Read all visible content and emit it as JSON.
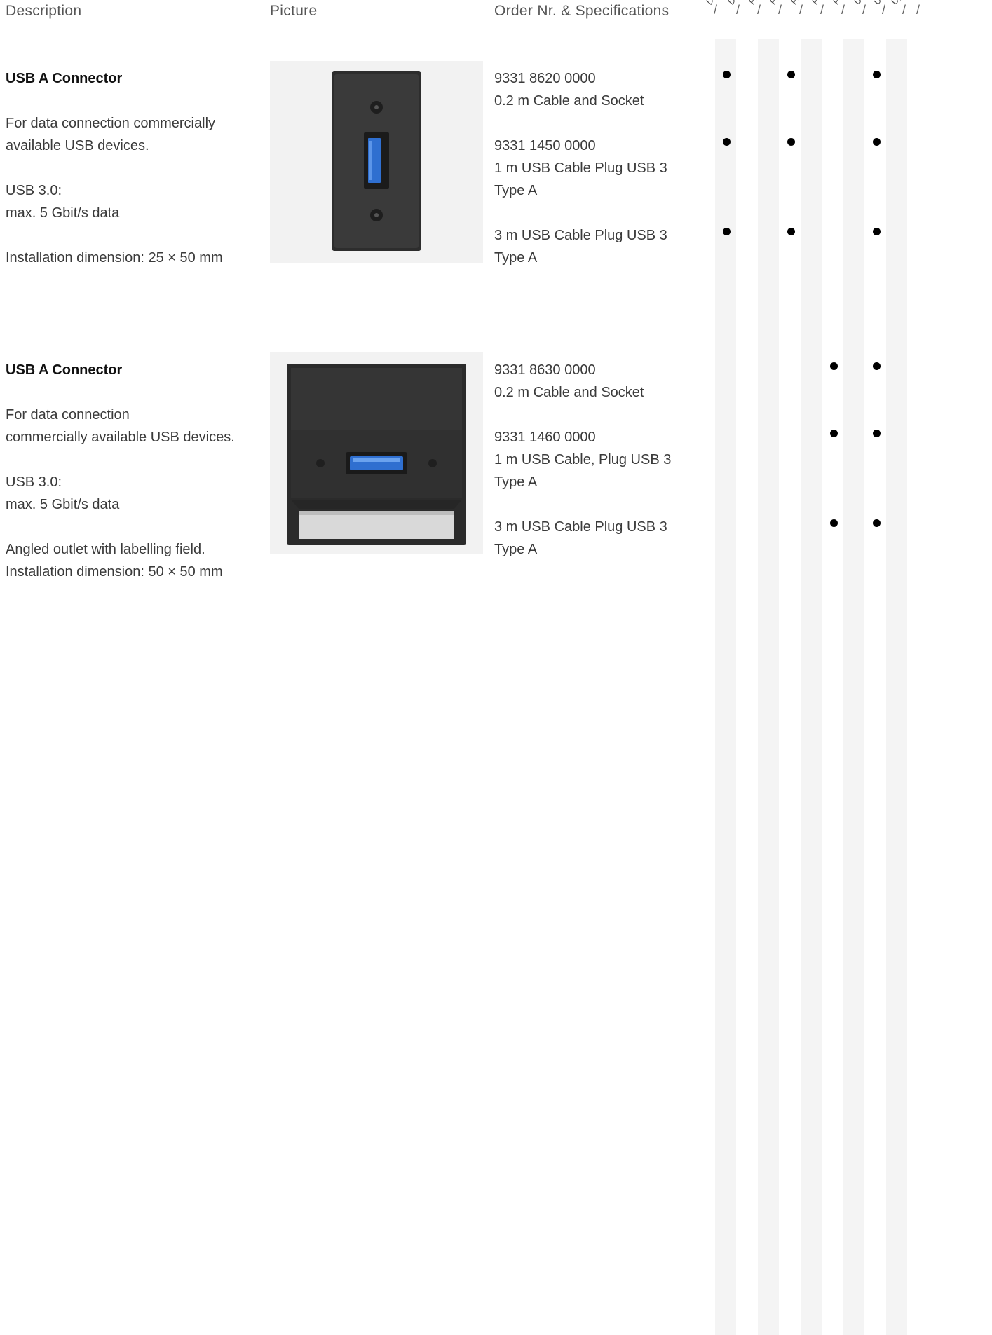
{
  "header": {
    "description": "Description",
    "picture": "Picture",
    "order": "Order Nr. & Specifications",
    "columns": [
      "Do",
      "Do",
      "Flip",
      "Fra",
      "Fra",
      "Po",
      "Po",
      "U-",
      "U-",
      "Up"
    ]
  },
  "products": [
    {
      "title": "USB A Connector",
      "desc1": "For data connection commercially",
      "desc2": "available USB devices.",
      "spec1": "USB 3.0:",
      "spec2": "max. 5 Gbit/s data",
      "install": "Installation dimension: 25 × 50 mm",
      "orders": [
        {
          "nr": "9331 8620 0000",
          "l1": "0.2 m Cable and Socket",
          "l2": ""
        },
        {
          "nr": "9331 1450 0000",
          "l1": "1 m USB Cable Plug USB 3",
          "l2": "Type A"
        },
        {
          "nr": "",
          "l1": "3 m USB Cable Plug USB 3",
          "l2": "Type A"
        }
      ]
    },
    {
      "title": "USB A Connector",
      "desc1": "For data connection",
      "desc2": "commercially available USB devices.",
      "spec1": "USB 3.0:",
      "spec2": "max. 5 Gbit/s data",
      "install1": "Angled outlet with labelling field.",
      "install2": "Installation dimension: 50 × 50 mm",
      "orders": [
        {
          "nr": "9331 8630 0000",
          "l1": "0.2 m Cable and Socket",
          "l2": ""
        },
        {
          "nr": "9331 1460 0000",
          "l1": "1 m USB Cable, Plug USB 3",
          "l2": "Type A"
        },
        {
          "nr": "",
          "l1": "3 m USB Cable Plug USB 3",
          "l2": "Type A"
        }
      ]
    }
  ]
}
